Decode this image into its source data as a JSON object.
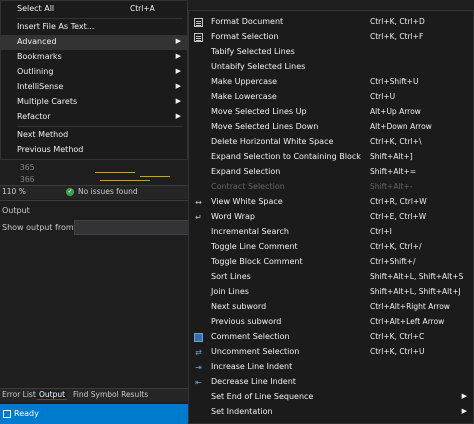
{
  "editor": {
    "line_numbers": [
      "365",
      "366"
    ],
    "zoom": "110 %",
    "issues_text": "No issues found"
  },
  "output_panel": {
    "title": "Output",
    "show_from_label": "Show output from:"
  },
  "bottom_tabs": [
    "Error List",
    "Output",
    "Find Symbol Results"
  ],
  "status_bar": {
    "text": "Ready"
  },
  "left_menu": {
    "items": [
      {
        "label": "Select All",
        "shortcut": "Ctrl+A"
      },
      {
        "label": "Insert File As Text..."
      },
      {
        "label": "Advanced",
        "submenu": true
      },
      {
        "label": "Bookmarks",
        "submenu": true
      },
      {
        "label": "Outlining",
        "submenu": true
      },
      {
        "label": "IntelliSense",
        "submenu": true
      },
      {
        "label": "Multiple Carets",
        "submenu": true
      },
      {
        "label": "Refactor",
        "submenu": true
      },
      {
        "label": "Next Method"
      },
      {
        "label": "Previous Method"
      }
    ]
  },
  "advanced_menu": {
    "items": [
      {
        "label": "Format Document",
        "shortcut": "Ctrl+K, Ctrl+D",
        "icon": "format-document-icon"
      },
      {
        "label": "Format Selection",
        "shortcut": "Ctrl+K, Ctrl+F",
        "icon": "format-selection-icon"
      },
      {
        "label": "Tabify Selected Lines",
        "shortcut": ""
      },
      {
        "label": "Untabify Selected Lines",
        "shortcut": ""
      },
      {
        "label": "Make Uppercase",
        "shortcut": "Ctrl+Shift+U"
      },
      {
        "label": "Make Lowercase",
        "shortcut": "Ctrl+U"
      },
      {
        "label": "Move Selected Lines Up",
        "shortcut": "Alt+Up Arrow"
      },
      {
        "label": "Move Selected Lines Down",
        "shortcut": "Alt+Down Arrow"
      },
      {
        "label": "Delete Horizontal White Space",
        "shortcut": "Ctrl+K, Ctrl+\\"
      },
      {
        "label": "Expand Selection to Containing Block",
        "shortcut": "Shift+Alt+]"
      },
      {
        "label": "Expand Selection",
        "shortcut": "Shift+Alt+="
      },
      {
        "label": "Contract Selection",
        "shortcut": "Shift+Alt+-",
        "disabled": true
      },
      {
        "label": "View White Space",
        "shortcut": "Ctrl+R, Ctrl+W",
        "icon": "white-space-icon"
      },
      {
        "label": "Word Wrap",
        "shortcut": "Ctrl+E, Ctrl+W",
        "icon": "word-wrap-icon"
      },
      {
        "label": "Incremental Search",
        "shortcut": "Ctrl+I"
      },
      {
        "label": "Toggle Line Comment",
        "shortcut": "Ctrl+K, Ctrl+/"
      },
      {
        "label": "Toggle Block Comment",
        "shortcut": "Ctrl+Shift+/"
      },
      {
        "label": "Sort Lines",
        "shortcut": "Shift+Alt+L, Shift+Alt+S"
      },
      {
        "label": "Join Lines",
        "shortcut": "Shift+Alt+L, Shift+Alt+J"
      },
      {
        "label": "Next subword",
        "shortcut": "Ctrl+Alt+Right Arrow"
      },
      {
        "label": "Previous subword",
        "shortcut": "Ctrl+Alt+Left Arrow"
      },
      {
        "label": "Comment Selection",
        "shortcut": "Ctrl+K, Ctrl+C",
        "icon": "comment-icon"
      },
      {
        "label": "Uncomment Selection",
        "shortcut": "Ctrl+K, Ctrl+U",
        "icon": "uncomment-icon"
      },
      {
        "label": "Increase Line Indent",
        "shortcut": "",
        "icon": "increase-indent-icon"
      },
      {
        "label": "Decrease Line Indent",
        "shortcut": "",
        "icon": "decrease-indent-icon"
      },
      {
        "label": "Set End of Line Sequence",
        "shortcut": "",
        "submenu": true
      },
      {
        "label": "Set Indentation",
        "shortcut": "",
        "submenu": true
      }
    ]
  },
  "colors": {
    "menu_bg": "#1b1b1c",
    "highlight": "#333334",
    "status_bar": "#007acc"
  }
}
